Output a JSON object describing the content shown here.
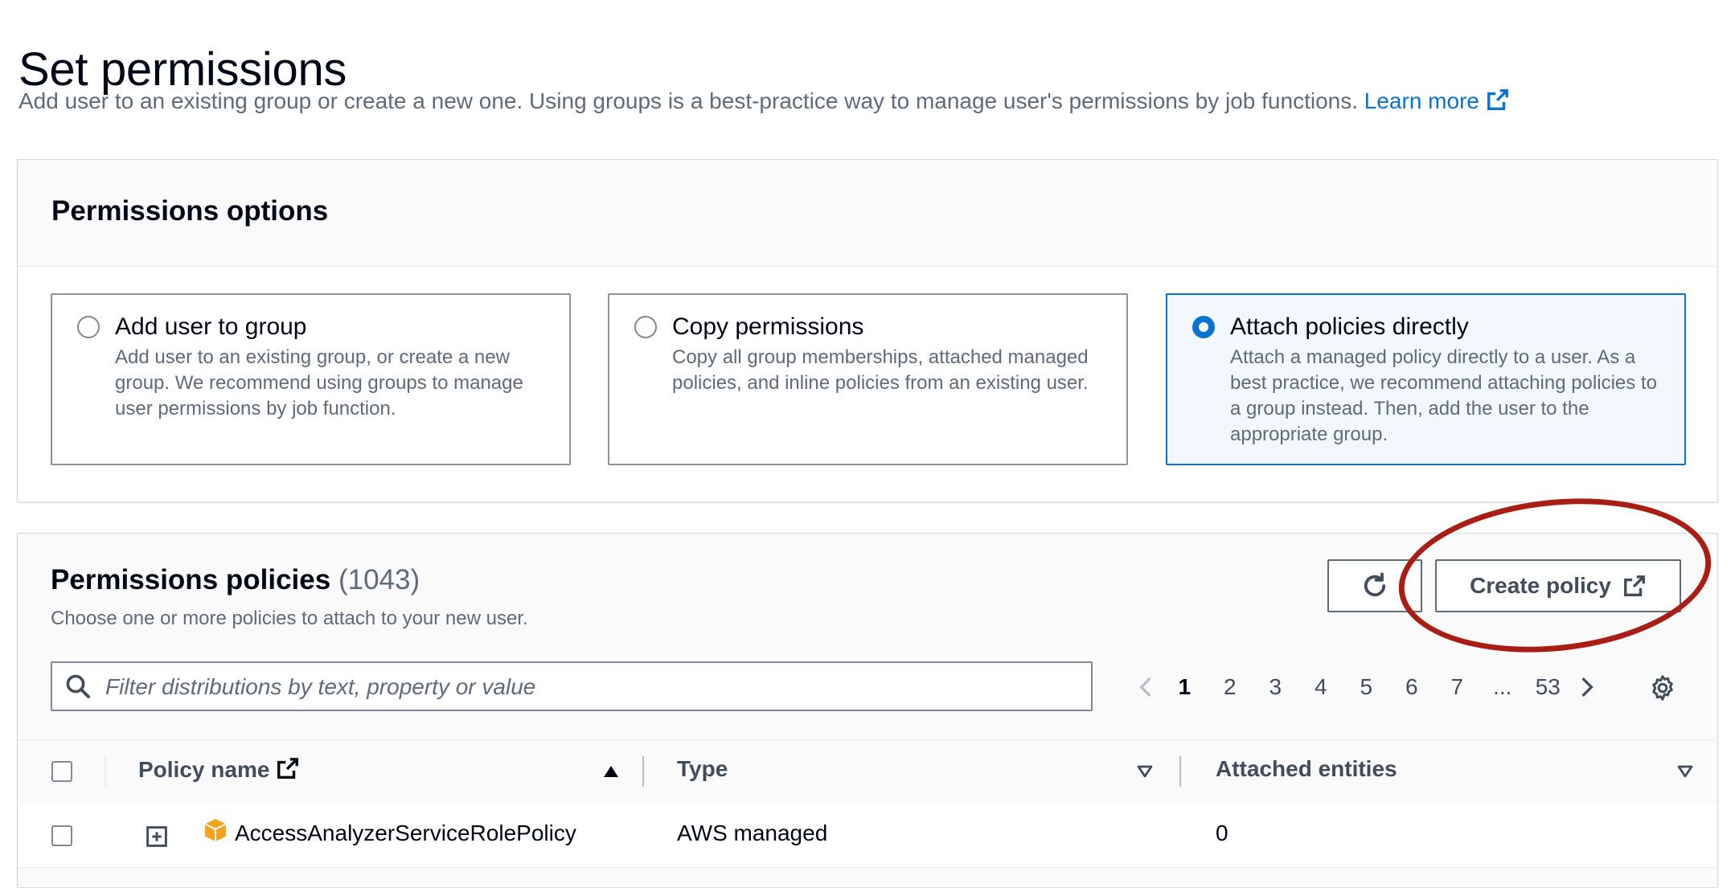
{
  "page": {
    "title": "Set permissions",
    "description": "Add user to an existing group or create a new one. Using groups is a best-practice way to manage user's permissions by job functions.",
    "learn_more": "Learn more"
  },
  "options": {
    "heading": "Permissions options",
    "tiles": [
      {
        "title": "Add user to group",
        "description": "Add user to an existing group, or create a new group. We recommend using groups to manage user permissions by job function.",
        "selected": false
      },
      {
        "title": "Copy permissions",
        "description": "Copy all group memberships, attached managed policies, and inline policies from an existing user.",
        "selected": false
      },
      {
        "title": "Attach policies directly",
        "description": "Attach a managed policy directly to a user. As a best practice, we recommend attaching policies to a group instead. Then, add the user to the appropriate group.",
        "selected": true
      }
    ]
  },
  "policies": {
    "heading": "Permissions policies",
    "count": "(1043)",
    "description": "Choose one or more policies to attach to your new user.",
    "create_label": "Create policy",
    "filter_placeholder": "Filter distributions by text, property or value",
    "pagination": {
      "pages": [
        "1",
        "2",
        "3",
        "4",
        "5",
        "6",
        "7",
        "...",
        "53"
      ],
      "current": "1"
    },
    "columns": {
      "policy_name": "Policy name",
      "type": "Type",
      "attached_entities": "Attached entities"
    },
    "rows": [
      {
        "policy_name": "AccessAnalyzerServiceRolePolicy",
        "type": "AWS managed",
        "attached_entities": "0"
      }
    ]
  },
  "colors": {
    "link": "#0972d3",
    "selected_border": "#0972d3",
    "selected_bg": "#f2f8fd",
    "annotation": "#a81d14",
    "aws_box": "#f7a21b"
  }
}
